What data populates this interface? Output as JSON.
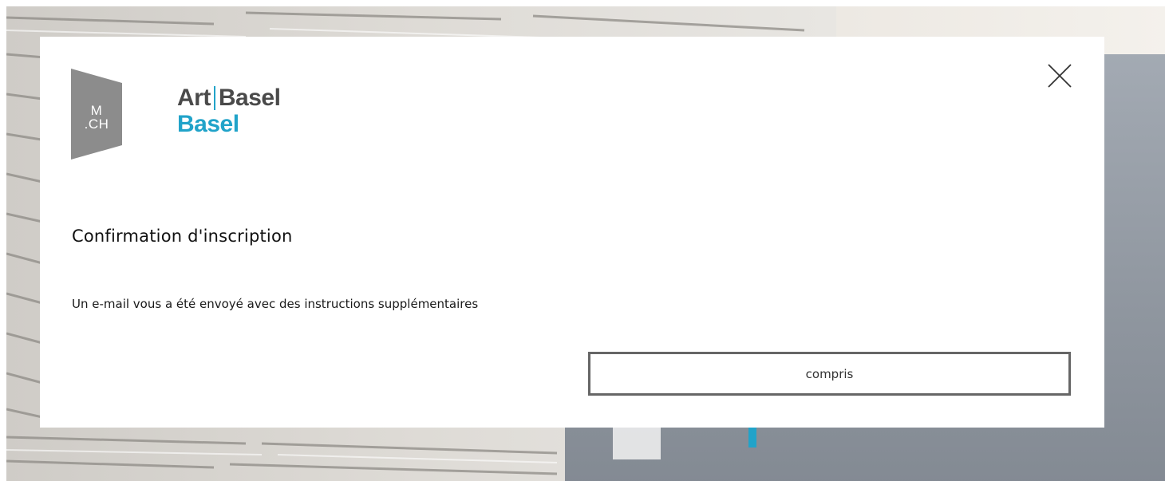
{
  "modal": {
    "logo_mch": {
      "line1": "M",
      "line2": ".CH"
    },
    "brand": {
      "art": "Art",
      "basel": "Basel",
      "city": "Basel"
    },
    "title": "Confirmation d'inscription",
    "message": "Un e-mail vous a été envoyé avec des instructions supplémentaires",
    "confirm_label": "compris",
    "close_icon": "close-icon"
  },
  "colors": {
    "brand_accent": "#21a3c9",
    "brand_gray": "#4a4a4a",
    "logo_gray": "#8c8c8c",
    "button_border": "#666666"
  }
}
